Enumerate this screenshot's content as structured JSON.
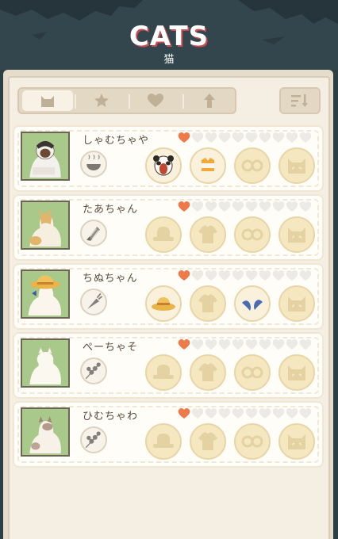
{
  "header": {
    "title": "CATS",
    "subtitle": "猫"
  },
  "toolbar": {
    "tabs": [
      {
        "icon": "cat-face-icon",
        "active": true
      },
      {
        "icon": "star-icon",
        "active": false
      },
      {
        "icon": "heart-icon",
        "active": false
      },
      {
        "icon": "arrow-up-icon",
        "active": false
      }
    ],
    "sort_icon": "sort-icon"
  },
  "colors": {
    "heart_filled": "#ee7a4a",
    "heart_empty": "#eceae6",
    "portrait_bg": "#a9c98a",
    "slot_bg": "#f5e7bf"
  },
  "cats": [
    {
      "name": "しゃむちゃや",
      "hearts_filled": 1,
      "hearts_total": 10,
      "food_icon": "bowl-icon",
      "slots": [
        {
          "item": "panda-hat-icon",
          "owned": true
        },
        {
          "item": "orange-vest-icon",
          "owned": true
        },
        {
          "item": "glasses-icon",
          "owned": false
        },
        {
          "item": "cat-face-toy-icon",
          "owned": false
        }
      ]
    },
    {
      "name": "たあちゃん",
      "hearts_filled": 1,
      "hearts_total": 10,
      "food_icon": "corn-icon",
      "slots": [
        {
          "item": "hat-icon",
          "owned": false
        },
        {
          "item": "shirt-icon",
          "owned": false
        },
        {
          "item": "glasses-icon",
          "owned": false
        },
        {
          "item": "cat-face-toy-icon",
          "owned": false
        }
      ]
    },
    {
      "name": "ちぬちゃん",
      "hearts_filled": 1,
      "hearts_total": 10,
      "food_icon": "carrot-icon",
      "slots": [
        {
          "item": "straw-hat-icon",
          "owned": true
        },
        {
          "item": "shirt-icon",
          "owned": false
        },
        {
          "item": "bat-wings-icon",
          "owned": true
        },
        {
          "item": "cat-face-toy-icon",
          "owned": false
        }
      ]
    },
    {
      "name": "ぺーちゃそ",
      "hearts_filled": 1,
      "hearts_total": 10,
      "food_icon": "skewer-icon",
      "slots": [
        {
          "item": "hat-icon",
          "owned": false
        },
        {
          "item": "shirt-icon",
          "owned": false
        },
        {
          "item": "glasses-icon",
          "owned": false
        },
        {
          "item": "cat-face-toy-icon",
          "owned": false
        }
      ]
    },
    {
      "name": "ひむちゃわ",
      "hearts_filled": 1,
      "hearts_total": 10,
      "food_icon": "skewer-icon",
      "slots": [
        {
          "item": "hat-icon",
          "owned": false
        },
        {
          "item": "shirt-icon",
          "owned": false
        },
        {
          "item": "glasses-icon",
          "owned": false
        },
        {
          "item": "cat-face-toy-icon",
          "owned": false
        }
      ]
    }
  ]
}
